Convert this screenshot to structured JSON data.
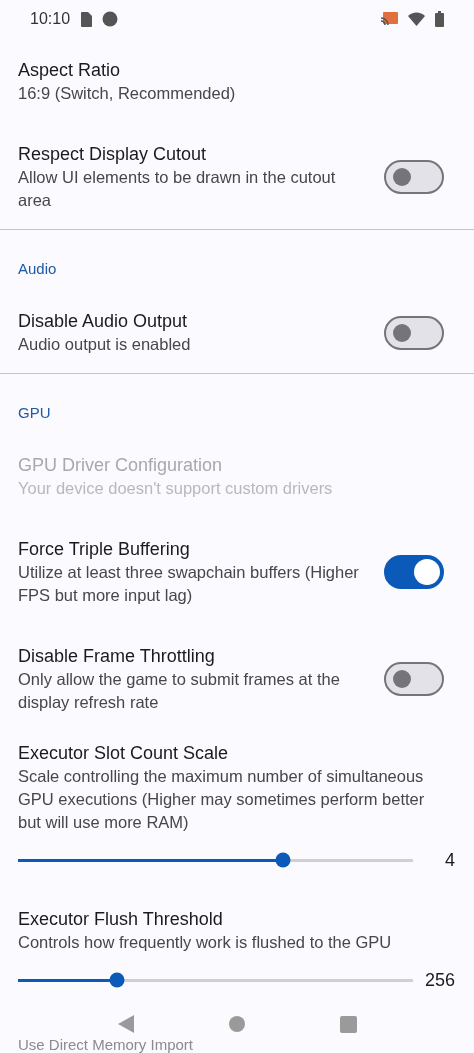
{
  "status_bar": {
    "time": "10:10"
  },
  "items": [
    {
      "kind": "text",
      "title": "Aspect Ratio",
      "subtitle": "16:9 (Switch, Recommended)",
      "disabled": false
    },
    {
      "kind": "switch",
      "title": "Respect Display Cutout",
      "subtitle": "Allow UI elements to be drawn in the cutout area",
      "on": false,
      "disabled": false
    },
    {
      "kind": "divider"
    },
    {
      "kind": "header",
      "title": "Audio"
    },
    {
      "kind": "switch",
      "title": "Disable Audio Output",
      "subtitle": "Audio output is enabled",
      "on": false,
      "disabled": false
    },
    {
      "kind": "divider"
    },
    {
      "kind": "header",
      "title": "GPU"
    },
    {
      "kind": "text",
      "title": "GPU Driver Configuration",
      "subtitle": "Your device doesn't support custom drivers",
      "disabled": true
    },
    {
      "kind": "switch",
      "title": "Force Triple Buffering",
      "subtitle": "Utilize at least three swapchain buffers (Higher FPS but more input lag)",
      "on": true,
      "disabled": false
    },
    {
      "kind": "switch",
      "title": "Disable Frame Throttling",
      "subtitle": "Only allow the game to submit frames at the display refresh rate",
      "on": false,
      "disabled": false
    },
    {
      "kind": "slider",
      "title": "Executor Slot Count Scale",
      "subtitle": "Scale controlling the maximum number of simultaneous GPU executions (Higher may sometimes perform better but will use more RAM)",
      "level": 0.67,
      "reading": "4",
      "disabled": false
    },
    {
      "kind": "slider",
      "title": "Executor Flush Threshold",
      "subtitle": "Controls how frequently work is flushed to the GPU",
      "level": 0.25,
      "reading": "256",
      "disabled": false
    },
    {
      "kind": "text",
      "title": "Use Direct Memory Import",
      "disabled": true
    }
  ]
}
